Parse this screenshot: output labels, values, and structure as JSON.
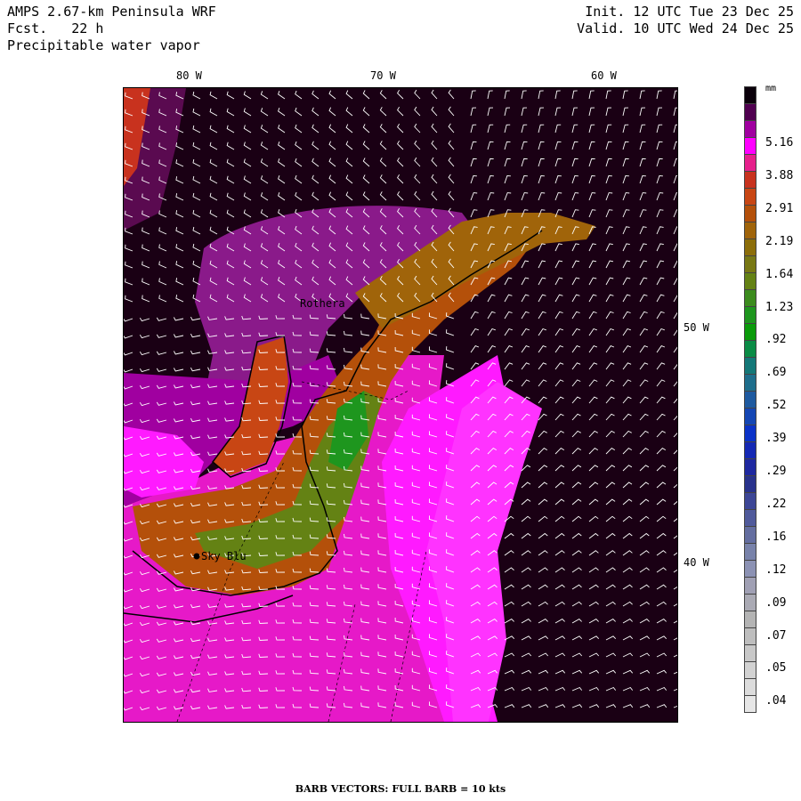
{
  "header": {
    "title": "AMPS 2.67-km Peninsula WRF",
    "forecast_label": "Fcst.",
    "forecast_value": "22 h",
    "field": "Precipitable water vapor",
    "init": "Init. 12 UTC Tue 23 Dec 25",
    "valid": "Valid. 10 UTC Wed 24 Dec 25"
  },
  "longitude_labels": [
    "80 W",
    "70 W",
    "60 W"
  ],
  "latitude_labels": [
    "50 W",
    "40 W"
  ],
  "stations": [
    {
      "name": "Rothera"
    },
    {
      "name": "Sky Blu"
    }
  ],
  "colorbar": {
    "unit": "mm",
    "labels": [
      "5.16",
      "3.88",
      "2.91",
      "2.19",
      "1.64",
      "1.23",
      ".92",
      ".69",
      ".52",
      ".39",
      ".29",
      ".22",
      ".16",
      ".12",
      ".09",
      ".07",
      ".05",
      ".04"
    ],
    "colors": [
      "#0a000a",
      "#500050",
      "#a000a0",
      "#ff00ff",
      "#e6208c",
      "#c8321e",
      "#c84614",
      "#b4500a",
      "#a0640a",
      "#8c6e0a",
      "#787814",
      "#648214",
      "#3c8c1e",
      "#1e961e",
      "#0a9b0a",
      "#0a8c46",
      "#147878",
      "#1e6e8c",
      "#1e5aa0",
      "#1446b4",
      "#0a32c8",
      "#1428b4",
      "#1e28a0",
      "#28328c",
      "#3c4696",
      "#505a9b",
      "#646ea0",
      "#7882aa",
      "#8c92b4",
      "#a0a0b4",
      "#aaaab4",
      "#b4b4b4",
      "#bebebe",
      "#c8c8c8",
      "#d2d2d2",
      "#dcdcdc",
      "#e6e6e6"
    ]
  },
  "footer": "BARB VECTORS:  FULL BARB = 10 kts"
}
